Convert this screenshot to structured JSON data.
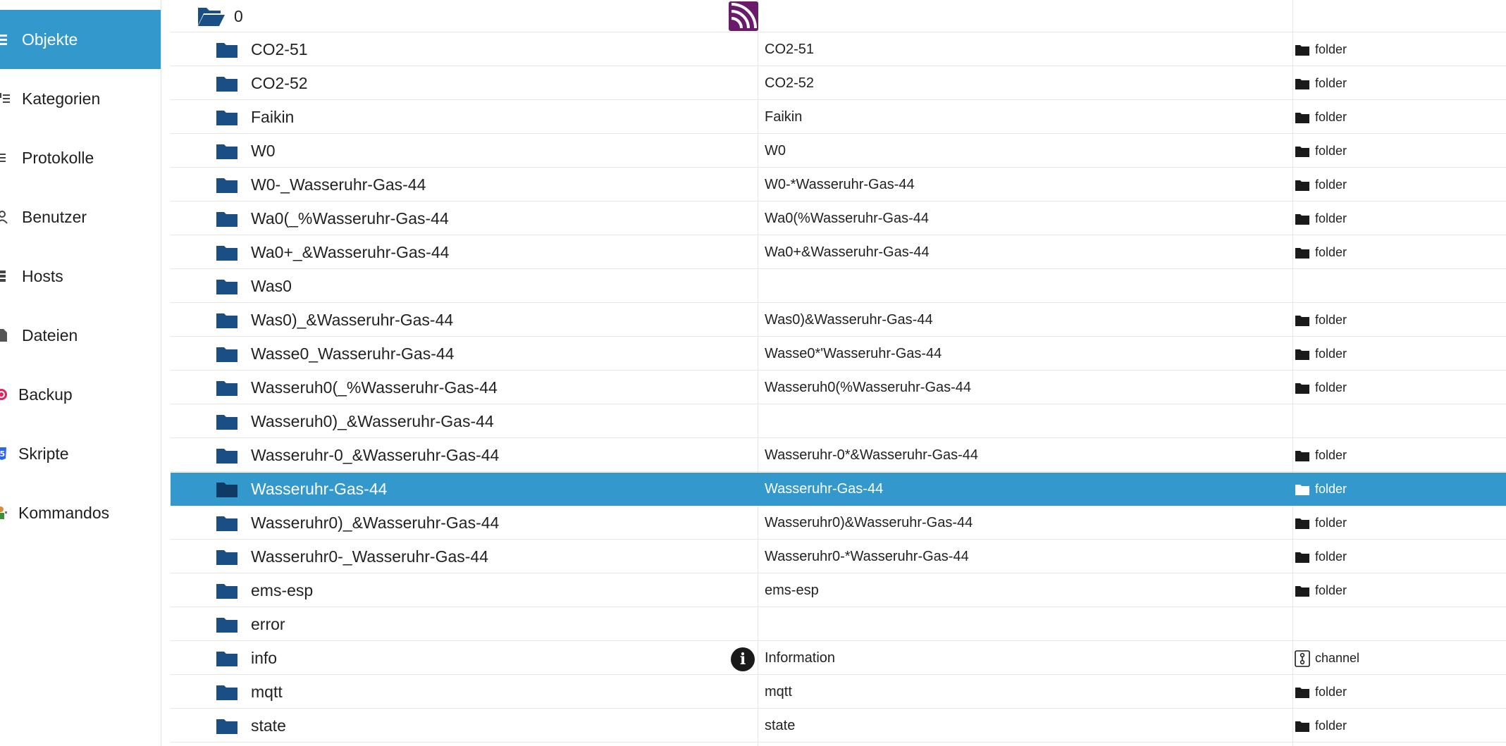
{
  "sidebar": {
    "items": [
      {
        "label": "Objekte",
        "active": true,
        "icon": "list-icon"
      },
      {
        "label": "Kategorien",
        "active": false,
        "icon": "categories-icon"
      },
      {
        "label": "Protokolle",
        "active": false,
        "icon": "log-icon"
      },
      {
        "label": "Benutzer",
        "active": false,
        "icon": "user-icon"
      },
      {
        "label": "Hosts",
        "active": false,
        "icon": "hosts-icon"
      },
      {
        "label": "Dateien",
        "active": false,
        "icon": "file-icon"
      },
      {
        "label": "Backup",
        "active": false,
        "icon": "backup-icon"
      },
      {
        "label": "Skripte",
        "active": false,
        "icon": "script-icon"
      },
      {
        "label": "Kommandos",
        "active": false,
        "icon": "command-icon"
      }
    ]
  },
  "tree": {
    "root": {
      "name": "0",
      "icon": "folder-open-icon",
      "logo": "rss-logo-icon"
    },
    "rows": [
      {
        "name": "CO2-51",
        "common_name": "CO2-51",
        "type": "folder"
      },
      {
        "name": "CO2-52",
        "common_name": "CO2-52",
        "type": "folder"
      },
      {
        "name": "Faikin",
        "common_name": "Faikin",
        "type": "folder"
      },
      {
        "name": "W0",
        "common_name": "W0",
        "type": "folder"
      },
      {
        "name": "W0-_Wasseruhr-Gas-44",
        "common_name": "W0-*Wasseruhr-Gas-44",
        "type": "folder"
      },
      {
        "name": "Wa0(_%Wasseruhr-Gas-44",
        "common_name": "Wa0(%Wasseruhr-Gas-44",
        "type": "folder"
      },
      {
        "name": "Wa0+_&Wasseruhr-Gas-44",
        "common_name": "Wa0+&Wasseruhr-Gas-44",
        "type": "folder"
      },
      {
        "name": "Was0",
        "common_name": "",
        "type": ""
      },
      {
        "name": "Was0)_&Wasseruhr-Gas-44",
        "common_name": "Was0)&Wasseruhr-Gas-44",
        "type": "folder"
      },
      {
        "name": "Wasse0_Wasseruhr-Gas-44",
        "common_name": "Wasse0*'Wasseruhr-Gas-44",
        "type": "folder"
      },
      {
        "name": "Wasseruh0(_%Wasseruhr-Gas-44",
        "common_name": "Wasseruh0(%Wasseruhr-Gas-44",
        "type": "folder"
      },
      {
        "name": "Wasseruh0)_&Wasseruhr-Gas-44",
        "common_name": "",
        "type": ""
      },
      {
        "name": "Wasseruhr-0_&Wasseruhr-Gas-44",
        "common_name": "Wasseruhr-0*&Wasseruhr-Gas-44",
        "type": "folder"
      },
      {
        "name": "Wasseruhr-Gas-44",
        "common_name": "Wasseruhr-Gas-44",
        "type": "folder",
        "selected": true
      },
      {
        "name": "Wasseruhr0)_&Wasseruhr-Gas-44",
        "common_name": "Wasseruhr0)&Wasseruhr-Gas-44",
        "type": "folder"
      },
      {
        "name": "Wasseruhr0-_Wasseruhr-Gas-44",
        "common_name": "Wasseruhr0-*Wasseruhr-Gas-44",
        "type": "folder"
      },
      {
        "name": "ems-esp",
        "common_name": "ems-esp",
        "type": "folder"
      },
      {
        "name": "error",
        "common_name": "",
        "type": ""
      },
      {
        "name": "info",
        "common_name": "Information",
        "type": "channel",
        "badge": "i"
      },
      {
        "name": "mqtt",
        "common_name": "mqtt",
        "type": "folder"
      },
      {
        "name": "state",
        "common_name": "state",
        "type": "folder"
      }
    ]
  },
  "colors": {
    "accent": "#3399cc",
    "folder": "#1a4f86",
    "logo": "#6b1a6b"
  }
}
